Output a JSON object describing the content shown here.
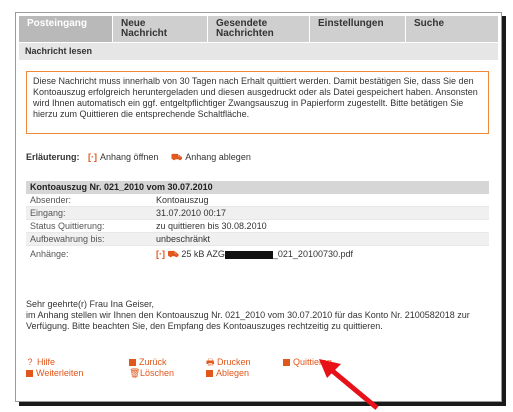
{
  "tabs": [
    {
      "label": "Posteingang"
    },
    {
      "label": "Neue\nNachricht"
    },
    {
      "label": "Gesendete\nNachrichten"
    },
    {
      "label": "Einstellungen"
    },
    {
      "label": "Suche"
    }
  ],
  "subbar": {
    "label": "Nachricht lesen"
  },
  "notice": {
    "text": "Diese Nachricht muss innerhalb von 30 Tagen nach Erhalt quittiert werden. Damit bestätigen Sie, dass Sie den Kontoauszug erfolgreich heruntergeladen und diesen ausgedruckt oder als Datei gespeichert haben. Ansonsten wird Ihnen automatisch ein ggf. entgeltpflichtiger Zwangsauszug in Papierform zugestellt. Bitte betätigen Sie hierzu zum Quittieren die entsprechende Schaltfläche."
  },
  "legend": {
    "label": "Erläuterung:",
    "open": "Anhang öffnen",
    "save": "Anhang ablegen"
  },
  "message": {
    "title": "Kontoauszug Nr. 021_2010 vom 30.07.2010",
    "fields": [
      {
        "key": "Absender:",
        "value": "Kontoauszug"
      },
      {
        "key": "Eingang:",
        "value": "31.07.2010 00:17"
      },
      {
        "key": "Status Quittierung:",
        "value": "zu quittieren bis 30.08.2010"
      },
      {
        "key": "Aufbewahrung bis:",
        "value": "unbeschränkt"
      }
    ],
    "attachments_label": "Anhänge:",
    "attachment_size": "25 kB",
    "attachment_prefix": "AZG",
    "attachment_suffix": "_021_20100730.pdf",
    "greeting": "Sehr geehrte(r) Frau Ina Geiser,",
    "body": "im Anhang stellen wir Ihnen den Kontoauszug Nr. 021_2010 vom 30.07.2010 für das Konto Nr. 2100582018 zur Verfügung. Bitte beachten Sie, den Empfang des Kontoauszuges rechtzeitig zu quittieren."
  },
  "actions": {
    "help": "Hilfe",
    "back": "Zurück",
    "print": "Drucken",
    "ack": "Quittieren",
    "forward": "Weiterleiten",
    "delete": "Löschen",
    "file": "Ablegen"
  },
  "colors": {
    "accent": "#e0561b",
    "notice_border": "#f08a3a",
    "arrow": "#e8111a"
  }
}
